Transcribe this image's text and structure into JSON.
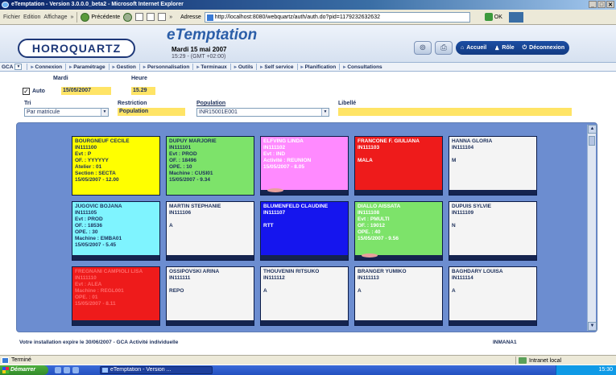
{
  "window": {
    "title": "eTemptation - Version 3.0.0.0_beta2 - Microsoft Internet Explorer",
    "buttons": [
      "_",
      "□",
      "✕"
    ]
  },
  "ie": {
    "menu": [
      "Fichier",
      "Edition",
      "Affichage"
    ],
    "more": "»",
    "back_label": "Précédente",
    "address_label": "Adresse",
    "url": "http://localhost:8080/webquartz/auth/auth.do?pid=1179232632632",
    "go_label": "OK",
    "status_text": "Terminé",
    "zone_text": "Intranet local"
  },
  "header": {
    "logo": "HOROQUARTZ",
    "brand": "eTemptation",
    "date": "Mardi 15 mai 2007",
    "time": "15:29 - (GMT +02:00)",
    "nav": {
      "home": "Accueil",
      "role": "Rôle",
      "logout": "Déconnexion"
    }
  },
  "tabs": {
    "module": "GCA",
    "items": [
      "Connexion",
      "Paramétrage",
      "Gestion",
      "Personnalisation",
      "Terminaux",
      "Outils",
      "Self service",
      "Planification",
      "Consultations"
    ]
  },
  "form": {
    "day_label": "Mardi",
    "hour_label": "Heure",
    "auto_label": "Auto",
    "auto_checked": "✓",
    "date_value": "15/05/2007",
    "hour_value": "15.29",
    "tri_label": "Tri",
    "tri_value": "Par matricule",
    "restriction_label": "Restriction",
    "restriction_value": "Population",
    "population_label": "Population",
    "population_value": "INR15001E001",
    "libelle_label": "Libellé"
  },
  "employees": [
    {
      "color": "#ffff00",
      "text": "#1c2f5a",
      "lines": [
        "BOURGNEUF CECILE",
        "IN111100",
        "Evt : P",
        "OF. : YYYYYY",
        "Atelier : 01",
        "Section : SECTA",
        "15/05/2007  -  12.00"
      ],
      "bar": false,
      "pill": false
    },
    {
      "color": "#7de36a",
      "text": "#1c2f5a",
      "lines": [
        "DUPUY MARJORIE",
        "IN111101",
        "Evt : PROD",
        "OF. : 18496",
        "OPE. : 10",
        "Machine : CUSI01",
        "15/05/2007  -  9.34"
      ],
      "bar": false,
      "pill": false
    },
    {
      "color": "#ff8aff",
      "text": "#ffffff",
      "lines": [
        "ELFVING LINDA",
        "IN111102",
        "Evt : IND",
        "Activité : REUNION",
        "15/05/2007  -  8.05"
      ],
      "bar": true,
      "pill": true
    },
    {
      "color": "#ee1b1b",
      "text": "#ffffff",
      "lines": [
        "FRANCONE F. GIULIANA",
        "IN111103",
        "",
        "MALA"
      ],
      "bar": true,
      "pill": false
    },
    {
      "color": "#f4f4f4",
      "text": "#1c2f5a",
      "lines": [
        "HANNA GLORIA",
        "IN111104",
        "",
        "M"
      ],
      "bar": true,
      "pill": false
    },
    {
      "color": "#7ff4ff",
      "text": "#1c2f5a",
      "lines": [
        "JUGOVIC BOJANA",
        "IN111105",
        "Evt : PROD",
        "OF. : 18536",
        "OPE. : 30",
        "Machine : EMBA01",
        "15/05/2007  -  5.45"
      ],
      "bar": true,
      "pill": false
    },
    {
      "color": "#f4f4f4",
      "text": "#1c2f5a",
      "lines": [
        "MARTIN STEPHANIE",
        "IN111106",
        "",
        "A"
      ],
      "bar": true,
      "pill": false
    },
    {
      "color": "#1515ee",
      "text": "#ffffff",
      "lines": [
        "BLUMENFELD CLAUDINE",
        "IN111107",
        "",
        "RTT"
      ],
      "bar": true,
      "pill": false
    },
    {
      "color": "#7de36a",
      "text": "#ffffff",
      "lines": [
        "DIALLO AISSATA",
        "IN111108",
        "Evt : PMULTI",
        "OF. : 19012",
        "OPE. : 40",
        "15/05/2007  -  9.56"
      ],
      "bar": true,
      "pill": true
    },
    {
      "color": "#f4f4f4",
      "text": "#1c2f5a",
      "lines": [
        "DUPUIS SYLVIE",
        "IN111109",
        "",
        "N"
      ],
      "bar": true,
      "pill": false
    },
    {
      "color": "#ee1b1b",
      "text": "#ff6a6a",
      "lines": [
        "FREGNANI CAMPIOLI LISA",
        "IN111110",
        "Evt : ALEA",
        "Machine : REGL001",
        "OPE. : 01",
        "15/05/2007  -  8.11"
      ],
      "bar": true,
      "pill": false
    },
    {
      "color": "#f4f4f4",
      "text": "#1c2f5a",
      "lines": [
        "OSSIPOVSKI ARINA",
        "IN111111",
        "",
        "REPO"
      ],
      "bar": true,
      "pill": false
    },
    {
      "color": "#f4f4f4",
      "text": "#1c2f5a",
      "lines": [
        "THOUVENIN RITSUKO",
        "IN111112",
        "",
        "A"
      ],
      "bar": true,
      "pill": false
    },
    {
      "color": "#f4f4f4",
      "text": "#1c2f5a",
      "lines": [
        "BRANGER YUMIKO",
        "IN111113",
        "",
        "A"
      ],
      "bar": true,
      "pill": false
    },
    {
      "color": "#f4f4f4",
      "text": "#1c2f5a",
      "lines": [
        "BAGHDARY LOUISA",
        "IN111114",
        "",
        "A"
      ],
      "bar": true,
      "pill": false
    }
  ],
  "footer": {
    "message": "Votre installation expire le 30/06/2007 - GCA Activité individuelle",
    "user": "INMANA1"
  },
  "taskbar": {
    "start": "Démarrer",
    "task": "eTemptation - Version ...",
    "clock": "15:30"
  }
}
